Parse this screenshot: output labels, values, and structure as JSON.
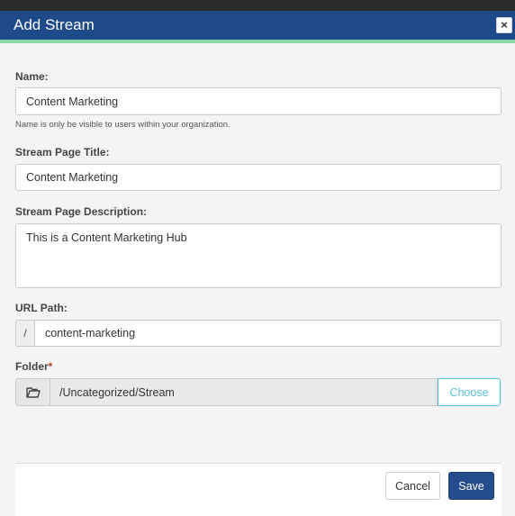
{
  "dialog": {
    "title": "Add Stream",
    "close_label": "×"
  },
  "form": {
    "name": {
      "label": "Name:",
      "value": "Content Marketing",
      "hint": "Name is only be visible to users within your organization."
    },
    "page_title": {
      "label": "Stream Page Title:",
      "value": "Content Marketing"
    },
    "page_description": {
      "label": "Stream Page Description:",
      "value": "This is a Content Marketing Hub"
    },
    "url_path": {
      "label": "URL Path:",
      "prefix": "/",
      "value": "content-marketing"
    },
    "folder": {
      "label": "Folder",
      "required_mark": "*",
      "icon": "folder-open-icon",
      "value": "/Uncategorized/Stream",
      "choose_label": "Choose"
    }
  },
  "footer": {
    "cancel_label": "Cancel",
    "save_label": "Save"
  },
  "colors": {
    "header": "#1e4a8a",
    "accent": "#8bd8a0",
    "primary_button": "#244c8f",
    "info": "#5bc0de",
    "required": "#c0392b"
  }
}
